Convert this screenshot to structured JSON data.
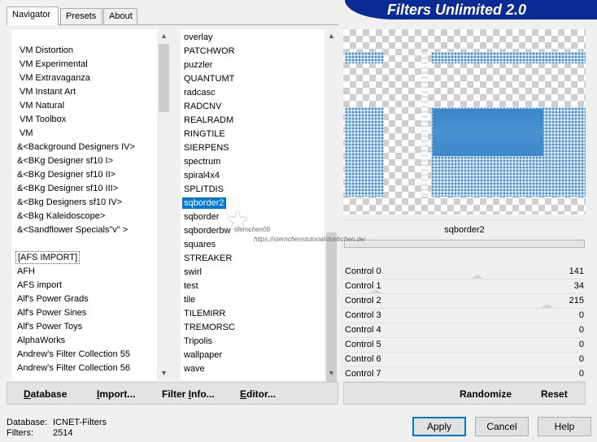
{
  "tabs": [
    {
      "label": "Navigator",
      "active": true
    },
    {
      "label": "Presets",
      "active": false
    },
    {
      "label": "About",
      "active": false
    }
  ],
  "brand": {
    "title": "Filters Unlimited 2.0",
    "color": "#0b2b94"
  },
  "categories": [
    "VM Distortion",
    "VM Experimental",
    "VM Extravaganza",
    "VM Instant Art",
    "VM Natural",
    "VM Toolbox",
    "VM",
    "&<Background Designers IV>",
    "&<BKg Designer sf10 I>",
    "&<BKg Designer sf10 II>",
    "&<BKg Designer sf10 III>",
    "&<Bkg Designers sf10 IV>",
    "&<Bkg Kaleidoscope>",
    "&<Sandflower Specials\"v\" >",
    "",
    "[AFS IMPORT]",
    "AFH",
    "AFS import",
    "Alf's Power Grads",
    "Alf's Power Sines",
    "Alf's Power Toys",
    "AlphaWorks",
    "Andrew's Filter Collection 55",
    "Andrew's Filter Collection 56"
  ],
  "filters": [
    "overlay",
    "PATCHWOR",
    "puzzler",
    "QUANTUMT",
    "radcasc",
    "RADCNV",
    "REALRADM",
    "RINGTILE",
    "SIERPENS",
    "spectrum",
    "spiral4x4",
    "SPLITDIS",
    "sqborder2",
    "sqborder",
    "sqborderbw",
    "squares",
    "STREAKER",
    "swirl",
    "test",
    "tile",
    "TILEMIRR",
    "TREMORSC",
    "Tripolis",
    "wallpaper",
    "wave"
  ],
  "selected_filter": "sqborder2",
  "toolbar": {
    "database": {
      "u": "D",
      "rest": "atabase"
    },
    "import": {
      "u": "I",
      "rest": "mport..."
    },
    "filter_info": {
      "pre": "Filter ",
      "u": "I",
      "rest": "nfo..."
    },
    "editor": {
      "u": "E",
      "rest": "ditor..."
    }
  },
  "filter_name": "sqborder2",
  "controls": [
    {
      "label": "Control 0",
      "value": "141",
      "level": 0.553
    },
    {
      "label": "Control 1",
      "value": "34",
      "level": 0.133
    },
    {
      "label": "Control 2",
      "value": "215",
      "level": 0.843
    },
    {
      "label": "Control 3",
      "value": "0",
      "level": 0
    },
    {
      "label": "Control 4",
      "value": "0",
      "level": 0
    },
    {
      "label": "Control 5",
      "value": "0",
      "level": 0
    },
    {
      "label": "Control 6",
      "value": "0",
      "level": 0
    },
    {
      "label": "Control 7",
      "value": "0",
      "level": 0
    }
  ],
  "randomize_label": "Randomize",
  "reset_label": "Reset",
  "info": {
    "database_label": "Database:",
    "database_value": "ICNET-Filters",
    "filters_label": "Filters:",
    "filters_value": "2514"
  },
  "buttons": {
    "apply": "Apply",
    "cancel": "Cancel",
    "help": "Help"
  },
  "watermark": {
    "name": "sternchen06",
    "url": "https://sternchenstutorialstuebchen.de/"
  },
  "colors": {
    "selection": "#0078d7",
    "preview_blue": "#3a86c8"
  }
}
